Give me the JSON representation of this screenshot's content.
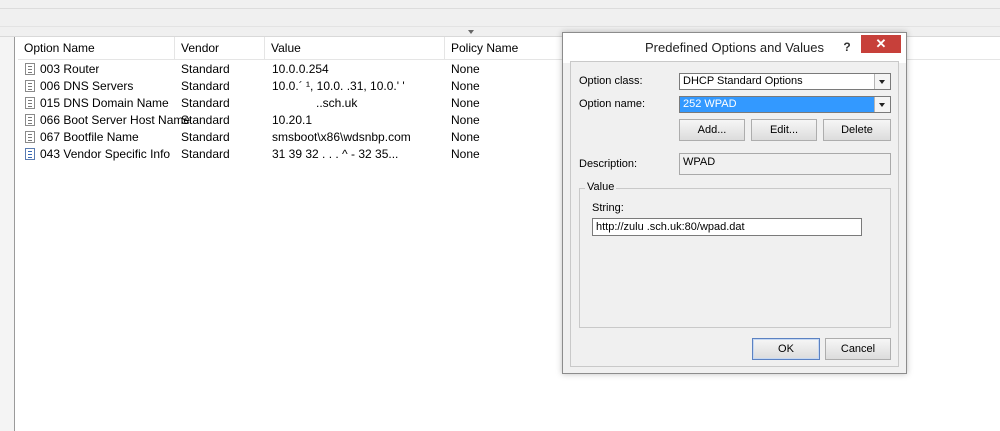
{
  "list": {
    "columns": [
      "Option Name",
      "Vendor",
      "Value",
      "Policy Name"
    ],
    "rows": [
      {
        "name": "003 Router",
        "vendor": "Standard",
        "value": "10.0.0.254",
        "policy": "None",
        "icon": "option-icon"
      },
      {
        "name": "006 DNS Servers",
        "vendor": "Standard",
        "value": "10.0.´   ¹, 10.0.   .31, 10.0.'     '",
        "policy": "None",
        "icon": "option-icon"
      },
      {
        "name": "015 DNS Domain Name",
        "vendor": "Standard",
        "value": "..sch.uk",
        "policy": "None",
        "icon": "option-icon"
      },
      {
        "name": "066 Boot Server Host Name",
        "vendor": "Standard",
        "value": "10.20.1",
        "policy": "None",
        "icon": "option-icon"
      },
      {
        "name": "067 Bootfile Name",
        "vendor": "Standard",
        "value": "smsboot\\x86\\wdsnbp.com",
        "policy": "None",
        "icon": "option-icon"
      },
      {
        "name": "043 Vendor Specific Info",
        "vendor": "Standard",
        "value": "31 39 32                 . . .   ^ - 32 35...",
        "policy": "None",
        "icon": "option-vendor-icon"
      }
    ]
  },
  "dialog": {
    "title": "Predefined Options and Values",
    "help": "?",
    "close": "✕",
    "option_class_label": "Option class:",
    "option_class_value": "DHCP Standard Options",
    "option_name_label": "Option name:",
    "option_name_value": "252 WPAD",
    "add_label": "Add...",
    "edit_label": "Edit...",
    "delete_label": "Delete",
    "description_label": "Description:",
    "description_value": "WPAD",
    "value_group_label": "Value",
    "string_label": "String:",
    "string_value": "http://zulu                   .sch.uk:80/wpad.dat",
    "ok_label": "OK",
    "cancel_label": "Cancel"
  }
}
